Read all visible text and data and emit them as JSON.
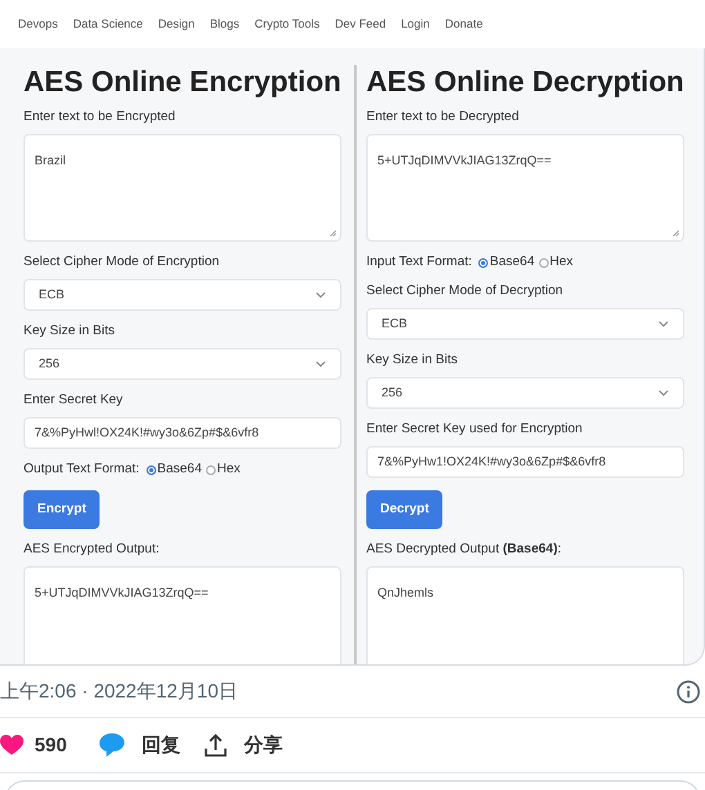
{
  "nav": {
    "links": [
      "Devops",
      "Data Science",
      "Design",
      "Blogs",
      "Crypto Tools",
      "Dev Feed",
      "Login",
      "Donate"
    ]
  },
  "panels": [
    {
      "title": "AES Online Encryption",
      "items": [
        {
          "kind": "textarea",
          "label": "Enter text to be Encrypted",
          "value": "Brazil"
        },
        {
          "kind": "select",
          "label": "Select Cipher Mode of Encryption",
          "value": "ECB"
        },
        {
          "kind": "select",
          "label": "Key Size in Bits",
          "value": "256"
        },
        {
          "kind": "input",
          "label": "Enter Secret Key",
          "value": "7&%PyHwl!OX24K!#wy3o&6Zp#$&6vfr8"
        },
        {
          "kind": "radio",
          "label": "Output Text Format:",
          "options": [
            {
              "label": "Base64",
              "selected": true
            },
            {
              "label": "Hex",
              "selected": false
            }
          ]
        },
        {
          "kind": "button",
          "label": "Encrypt"
        },
        {
          "kind": "output",
          "label": "AES Encrypted Output:",
          "value": "5+UTJqDIMVVkJIAG13ZrqQ=="
        }
      ]
    },
    {
      "title": "AES Online Decryption",
      "items": [
        {
          "kind": "textarea",
          "label": "Enter text to be Decrypted",
          "value": "5+UTJqDIMVVkJIAG13ZrqQ=="
        },
        {
          "kind": "radio",
          "label": "Input Text Format:",
          "options": [
            {
              "label": "Base64",
              "selected": true
            },
            {
              "label": "Hex",
              "selected": false
            }
          ]
        },
        {
          "kind": "select",
          "label": "Select Cipher Mode of Decryption",
          "value": "ECB"
        },
        {
          "kind": "select",
          "label": "Key Size in Bits",
          "value": "256"
        },
        {
          "kind": "input",
          "label": "Enter Secret Key used for Encryption",
          "value": "7&%PyHw1!OX24K!#wy3o&6Zp#$&6vfr8"
        },
        {
          "kind": "button",
          "label": "Decrypt"
        },
        {
          "kind": "output",
          "label": "AES Decrypted Output **(Base64)**:",
          "value": "QnJhemls"
        }
      ]
    }
  ],
  "tweet": {
    "timestamp": "上午2:06 · 2022年12月10日",
    "likes": "590",
    "reply": "回复",
    "share": "分享"
  }
}
